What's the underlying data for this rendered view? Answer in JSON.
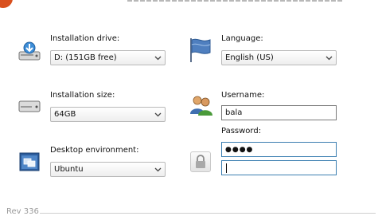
{
  "form": {
    "installation_drive": {
      "label": "Installation drive:",
      "value": "D: (151GB free)"
    },
    "installation_size": {
      "label": "Installation size:",
      "value": "64GB"
    },
    "desktop_environment": {
      "label": "Desktop environment:",
      "value": "Ubuntu"
    },
    "language": {
      "label": "Language:",
      "value": "English (US)"
    },
    "username": {
      "label": "Username:",
      "value": "bala"
    },
    "password": {
      "label": "Password:",
      "value": "●●●●"
    },
    "password_confirm": {
      "value": ""
    }
  },
  "footer": {
    "revision": "Rev 336"
  },
  "icons": {
    "drive": "hard-drive-download-icon",
    "size": "hard-drive-icon",
    "desktop": "desktop-window-icon",
    "language": "flag-icon",
    "username": "users-icon",
    "password": "padlock-icon"
  },
  "colors": {
    "accent": "#d9501e",
    "focus_border": "#3c7fb1"
  }
}
